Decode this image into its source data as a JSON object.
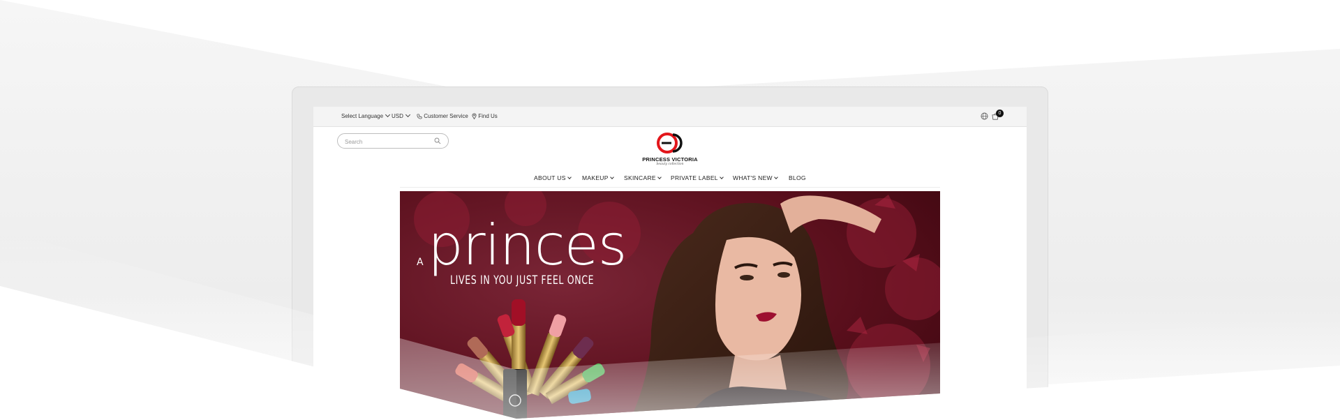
{
  "topbar": {
    "language_label": "Select Language",
    "currency_label": "USD",
    "customer_service_label": "Customer Service",
    "find_us_label": "Find Us",
    "cart_count": "0"
  },
  "search": {
    "placeholder": "Search"
  },
  "brand": {
    "name": "PRINCESS VICTORIA",
    "tagline": "beauty collection"
  },
  "nav": {
    "items": [
      {
        "label": "ABOUT US"
      },
      {
        "label": "MAKEUP"
      },
      {
        "label": "SKINCARE"
      },
      {
        "label": "PRIVATE LABEL"
      },
      {
        "label": "WHAT'S NEW"
      },
      {
        "label": "BLOG"
      }
    ]
  },
  "banner": {
    "headline_prefix": "A",
    "headline": "princes",
    "subline": "LIVES IN YOU JUST FEEL ONCE"
  },
  "colors": {
    "brand_red": "#e3161b",
    "banner_bg": "#5a0f1c",
    "topbar_bg": "#f4f4f4"
  },
  "icons": [
    "chevron-down-icon",
    "phone-icon",
    "location-pin-icon",
    "globe-icon",
    "cart-icon",
    "search-icon"
  ]
}
